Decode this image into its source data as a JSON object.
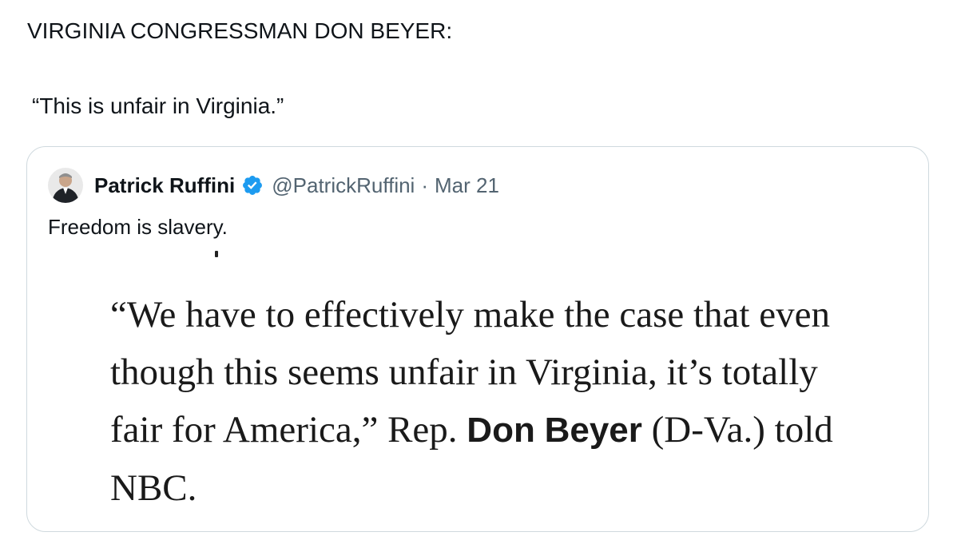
{
  "post": {
    "line1": "VIRGINIA CONGRESSMAN DON BEYER:",
    "line2": "“This is unfair in Virginia.”"
  },
  "quoted_post": {
    "author_name": "Patrick Ruffini",
    "handle": "@PatrickRuffini",
    "separator": "·",
    "date": "Mar 21",
    "text": "Freedom is slavery.",
    "verified_icon": "verified-badge-icon",
    "verified_color": "#1d9bf0",
    "media": {
      "quote_part1": "“We have to effectively make the case that even though this seems unfair in Virginia, it’s totally fair for America,” Rep. ",
      "name_first": "Don",
      "name_last": "Beyer",
      "quote_part2": " (D-Va.) told NBC."
    }
  }
}
